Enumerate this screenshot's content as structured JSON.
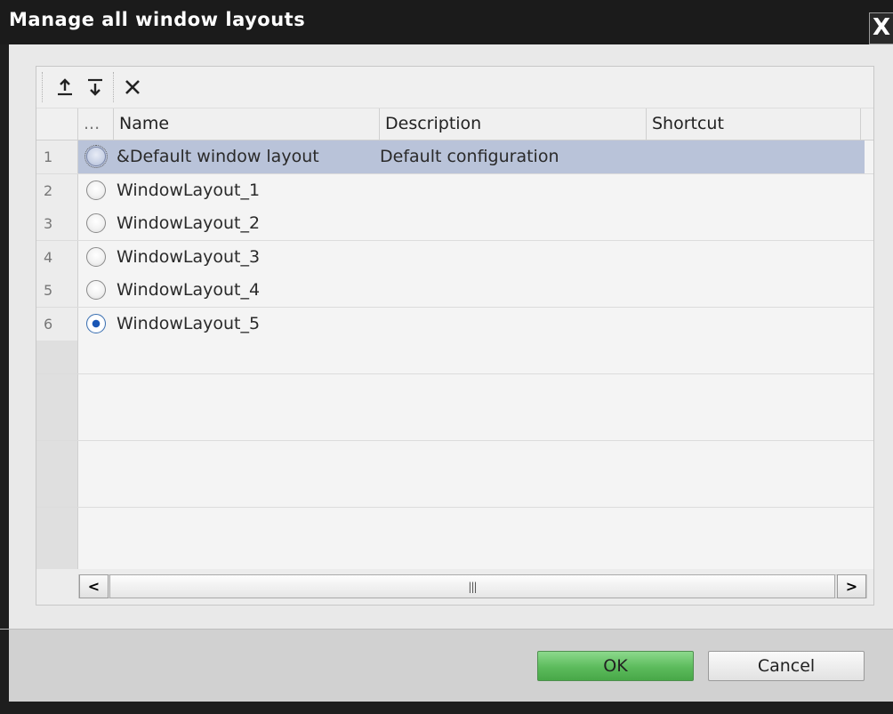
{
  "dialog": {
    "title": "Manage all window layouts",
    "close_symbol": "X"
  },
  "toolbar": {
    "buttons": [
      {
        "icon": "move-up-icon"
      },
      {
        "icon": "move-down-icon"
      },
      {
        "icon": "delete-icon"
      }
    ]
  },
  "table": {
    "headers": {
      "select": "...",
      "name": "Name",
      "description": "Description",
      "shortcut": "Shortcut"
    },
    "rows": [
      {
        "num": "1",
        "name": "&Default window layout",
        "description": "Default configuration",
        "shortcut": "",
        "checked": false,
        "selected": true
      },
      {
        "num": "2",
        "name": "WindowLayout_1",
        "description": "",
        "shortcut": "",
        "checked": false,
        "selected": false
      },
      {
        "num": "3",
        "name": "WindowLayout_2",
        "description": "",
        "shortcut": "",
        "checked": false,
        "selected": false
      },
      {
        "num": "4",
        "name": "WindowLayout_3",
        "description": "",
        "shortcut": "",
        "checked": false,
        "selected": false
      },
      {
        "num": "5",
        "name": "WindowLayout_4",
        "description": "",
        "shortcut": "",
        "checked": false,
        "selected": false
      },
      {
        "num": "6",
        "name": "WindowLayout_5",
        "description": "",
        "shortcut": "",
        "checked": true,
        "selected": false
      }
    ]
  },
  "scrollbar": {
    "left_arrow": "<",
    "right_arrow": ">",
    "thumb_grip": "|||"
  },
  "buttons": {
    "ok": "OK",
    "cancel": "Cancel"
  },
  "colors": {
    "title_bar": "#1b1b1b",
    "selected_row": "#b9c3d9",
    "ok_button": "#5cbb5c",
    "radio_checked": "#1a56b5"
  }
}
